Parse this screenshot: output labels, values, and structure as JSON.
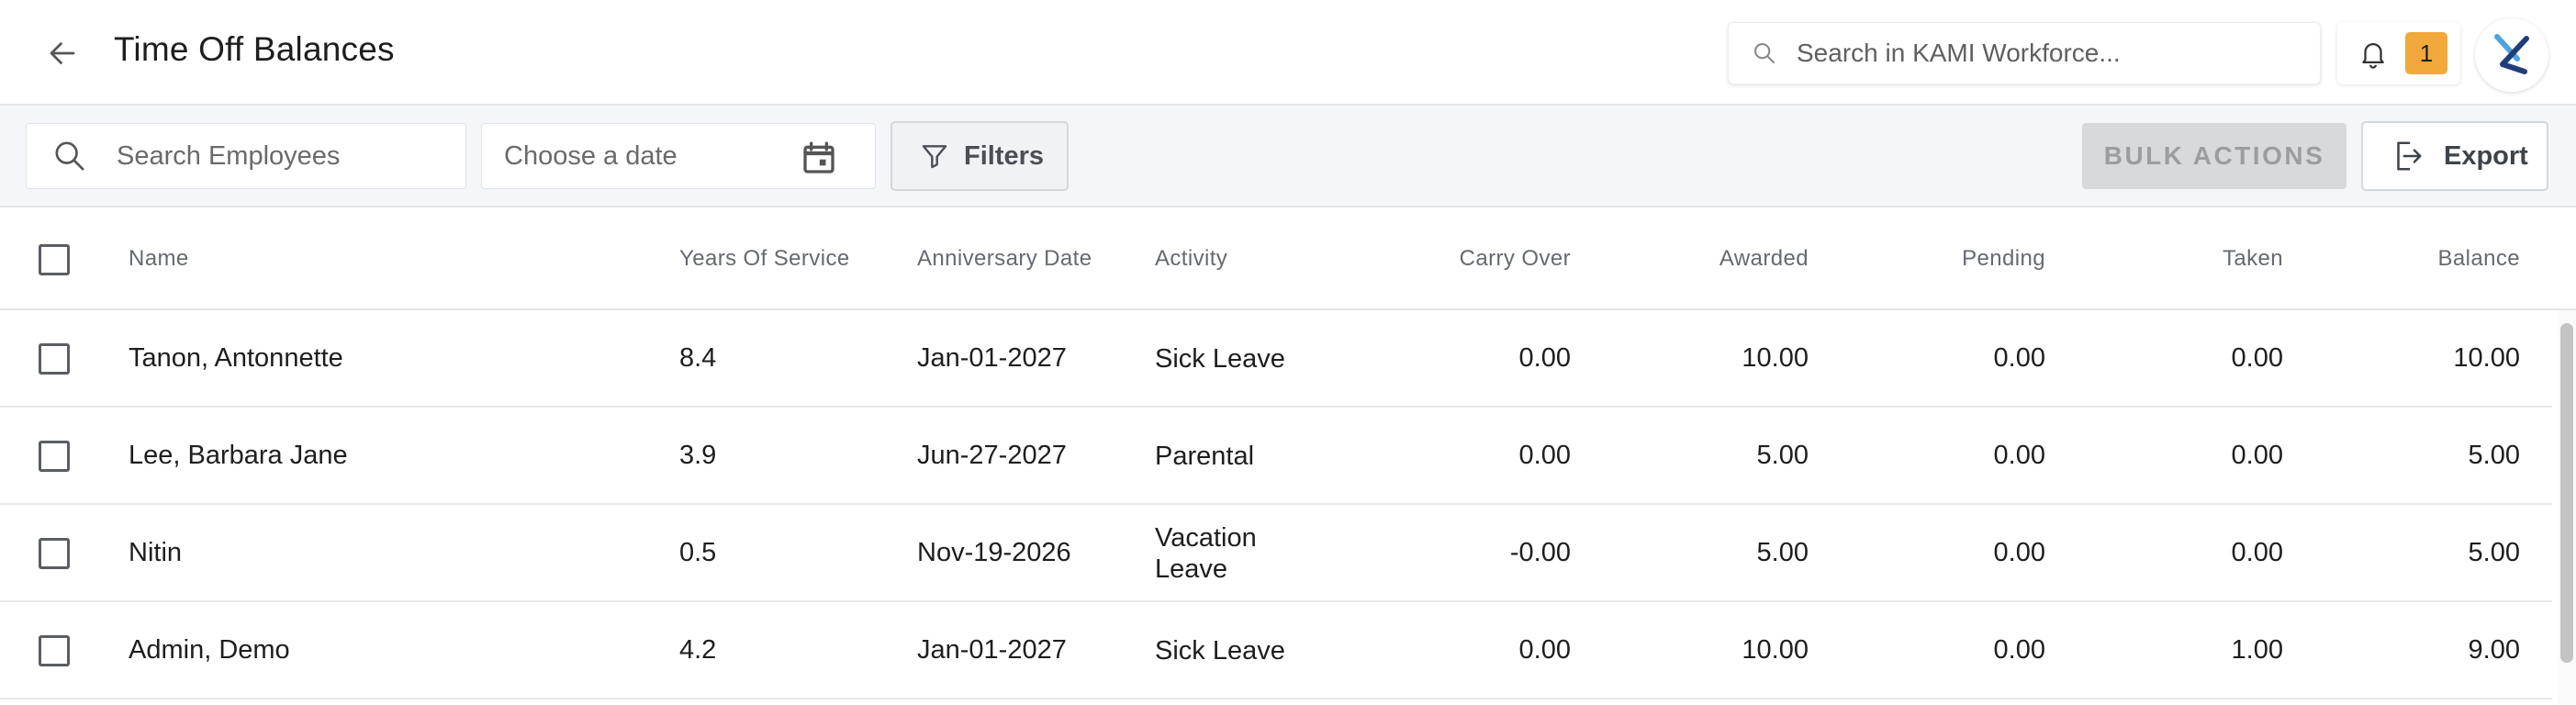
{
  "header": {
    "title": "Time Off Balances",
    "global_search_placeholder": "Search in KAMI Workforce...",
    "notification_count": "1"
  },
  "toolbar": {
    "employee_search_placeholder": "Search Employees",
    "date_placeholder": "Choose a date",
    "filters_label": "Filters",
    "bulk_actions_label": "BULK ACTIONS",
    "export_label": "Export"
  },
  "table": {
    "columns": {
      "name": "Name",
      "years": "Years Of Service",
      "anniversary": "Anniversary Date",
      "activity": "Activity",
      "carry_over": "Carry Over",
      "awarded": "Awarded",
      "pending": "Pending",
      "taken": "Taken",
      "balance": "Balance"
    },
    "rows": [
      {
        "name": "Tanon, Antonnette",
        "years": "8.4",
        "anniversary": "Jan-01-2027",
        "activity": "Sick Leave",
        "carry_over": "0.00",
        "awarded": "10.00",
        "pending": "0.00",
        "taken": "0.00",
        "balance": "10.00"
      },
      {
        "name": "Lee, Barbara Jane",
        "years": "3.9",
        "anniversary": "Jun-27-2027",
        "activity": "Parental",
        "carry_over": "0.00",
        "awarded": "5.00",
        "pending": "0.00",
        "taken": "0.00",
        "balance": "5.00"
      },
      {
        "name": "Nitin",
        "years": "0.5",
        "anniversary": "Nov-19-2026",
        "activity": "Vacation Leave",
        "carry_over": "-0.00",
        "awarded": "5.00",
        "pending": "0.00",
        "taken": "0.00",
        "balance": "5.00"
      },
      {
        "name": "Admin, Demo",
        "years": "4.2",
        "anniversary": "Jan-01-2027",
        "activity": "Sick Leave",
        "carry_over": "0.00",
        "awarded": "10.00",
        "pending": "0.00",
        "taken": "1.00",
        "balance": "9.00"
      }
    ]
  },
  "colors": {
    "badge": "#f2a93b",
    "brand_dark": "#1f3f7a",
    "brand_light": "#4ea3e0"
  },
  "icons": [
    "back-arrow-icon",
    "search-icon",
    "bell-icon",
    "kami-logo-icon",
    "calendar-icon",
    "filter-icon",
    "export-icon"
  ]
}
